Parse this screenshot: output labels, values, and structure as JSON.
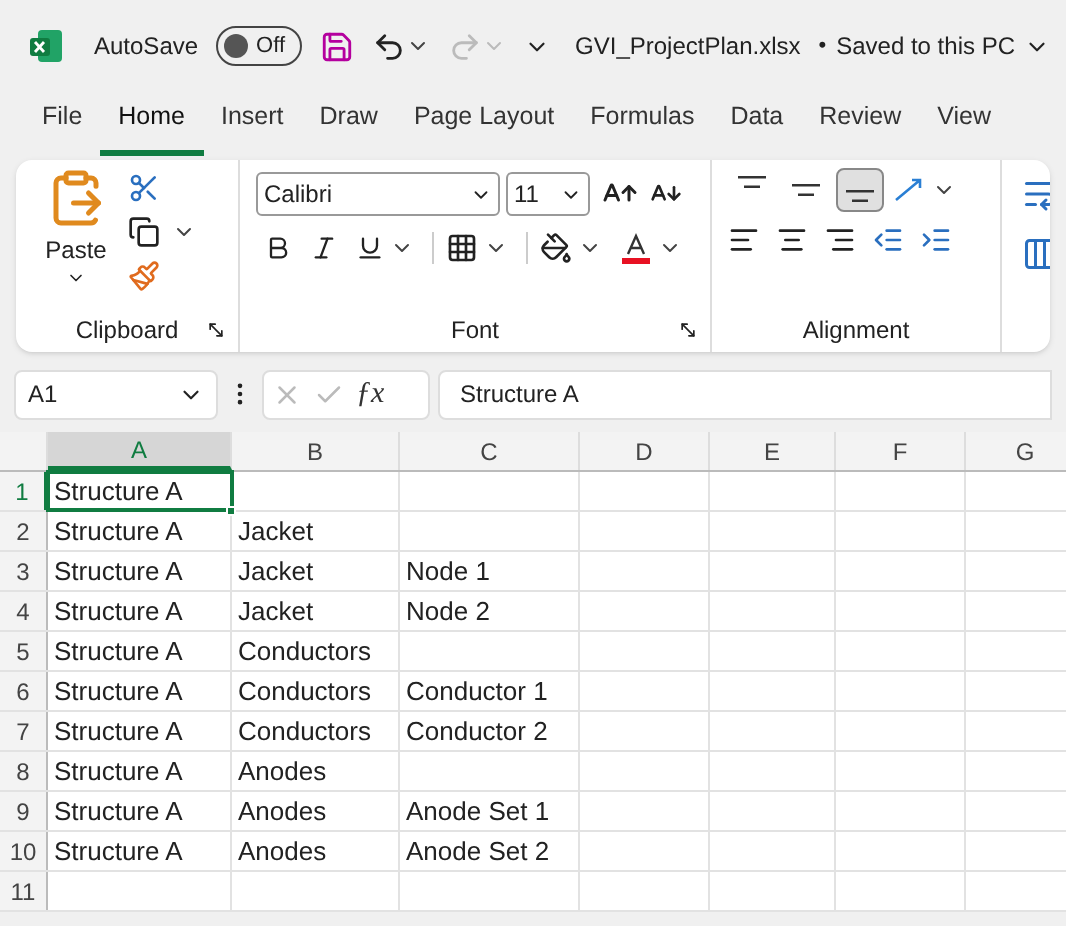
{
  "title_bar": {
    "autosave": {
      "label": "AutoSave",
      "on": false,
      "state_label": "Off"
    },
    "file_title": "GVI_ProjectPlan.xlsx",
    "separator": "•",
    "save_state": "Saved to this PC"
  },
  "tabs": [
    {
      "label": "File",
      "selected": false
    },
    {
      "label": "Home",
      "selected": true
    },
    {
      "label": "Insert",
      "selected": false
    },
    {
      "label": "Draw",
      "selected": false
    },
    {
      "label": "Page Layout",
      "selected": false
    },
    {
      "label": "Formulas",
      "selected": false
    },
    {
      "label": "Data",
      "selected": false
    },
    {
      "label": "Review",
      "selected": false
    },
    {
      "label": "View",
      "selected": false
    }
  ],
  "ribbon": {
    "clipboard": {
      "paste_label": "Paste",
      "group_label": "Clipboard"
    },
    "font": {
      "font_name": "Calibri",
      "font_size": "11",
      "group_label": "Font"
    },
    "alignment": {
      "group_label": "Alignment",
      "vertical": [
        {
          "kind": "top",
          "selected": false
        },
        {
          "kind": "middle",
          "selected": false
        },
        {
          "kind": "bottom",
          "selected": true
        }
      ]
    }
  },
  "formula_bar": {
    "name_box": "A1",
    "function_label": "ƒx",
    "formula": "Structure A"
  },
  "sheet": {
    "columns": [
      {
        "label": "A",
        "selected": true
      },
      {
        "label": "B",
        "selected": false
      },
      {
        "label": "C",
        "selected": false
      },
      {
        "label": "D",
        "selected": false
      },
      {
        "label": "E",
        "selected": false
      },
      {
        "label": "F",
        "selected": false
      },
      {
        "label": "G",
        "selected": false
      }
    ],
    "rows": [
      {
        "number": "1",
        "selected": true,
        "cells": [
          "Structure A",
          "",
          ""
        ]
      },
      {
        "number": "2",
        "selected": false,
        "cells": [
          "Structure A",
          "Jacket",
          ""
        ]
      },
      {
        "number": "3",
        "selected": false,
        "cells": [
          "Structure A",
          "Jacket",
          "Node 1"
        ]
      },
      {
        "number": "4",
        "selected": false,
        "cells": [
          "Structure A",
          "Jacket",
          "Node 2"
        ]
      },
      {
        "number": "5",
        "selected": false,
        "cells": [
          "Structure A",
          "Conductors",
          ""
        ]
      },
      {
        "number": "6",
        "selected": false,
        "cells": [
          "Structure A",
          "Conductors",
          "Conductor 1"
        ]
      },
      {
        "number": "7",
        "selected": false,
        "cells": [
          "Structure A",
          "Conductors",
          "Conductor 2"
        ]
      },
      {
        "number": "8",
        "selected": false,
        "cells": [
          "Structure A",
          "Anodes",
          ""
        ]
      },
      {
        "number": "9",
        "selected": false,
        "cells": [
          "Structure A",
          "Anodes",
          "Anode Set 1"
        ]
      },
      {
        "number": "10",
        "selected": false,
        "cells": [
          "Structure A",
          "Anodes",
          "Anode Set 2"
        ]
      },
      {
        "number": "11",
        "selected": false,
        "cells": [
          "",
          "",
          ""
        ]
      }
    ]
  }
}
